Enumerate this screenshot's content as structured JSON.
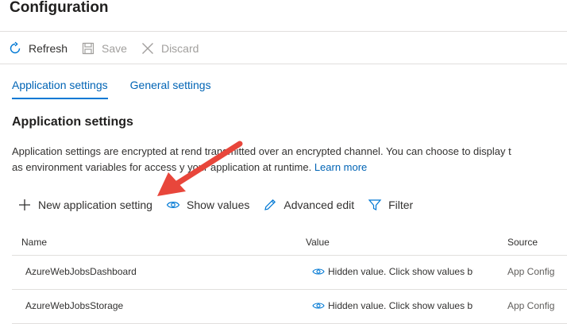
{
  "page_title": "Configuration",
  "command_bar": {
    "refresh": "Refresh",
    "save": "Save",
    "discard": "Discard"
  },
  "tabs": [
    {
      "label": "Application settings",
      "active": true
    },
    {
      "label": "General settings",
      "active": false
    }
  ],
  "section": {
    "title": "Application settings",
    "desc_line1": "Application settings are encrypted at re",
    "desc_line1_end": "nd transmitted over an encrypted channel. You can choose to display t",
    "desc_line2_start": "as environment variables for access ",
    "desc_line2_mid": "y your application at runtime.",
    "learn_more": "Learn more"
  },
  "grid_toolbar": {
    "new_setting": "New application setting",
    "show_values": "Show values",
    "advanced_edit": "Advanced edit",
    "filter": "Filter"
  },
  "table": {
    "headers": {
      "name": "Name",
      "value": "Value",
      "source": "Source"
    },
    "rows": [
      {
        "name": "AzureWebJobsDashboard",
        "value": "Hidden value. Click show values button",
        "source": "App Config"
      },
      {
        "name": "AzureWebJobsStorage",
        "value": "Hidden value. Click show values button",
        "source": "App Config"
      }
    ]
  },
  "colors": {
    "link": "#0064b5",
    "accent": "#0078d4",
    "disabled": "#a19f9d",
    "annotation_arrow": "#e8463b"
  },
  "icons": {
    "refresh": "refresh-icon",
    "save": "save-icon",
    "discard": "discard-icon",
    "add": "plus-icon",
    "show": "eye-icon",
    "edit": "pencil-icon",
    "filter": "funnel-icon"
  }
}
